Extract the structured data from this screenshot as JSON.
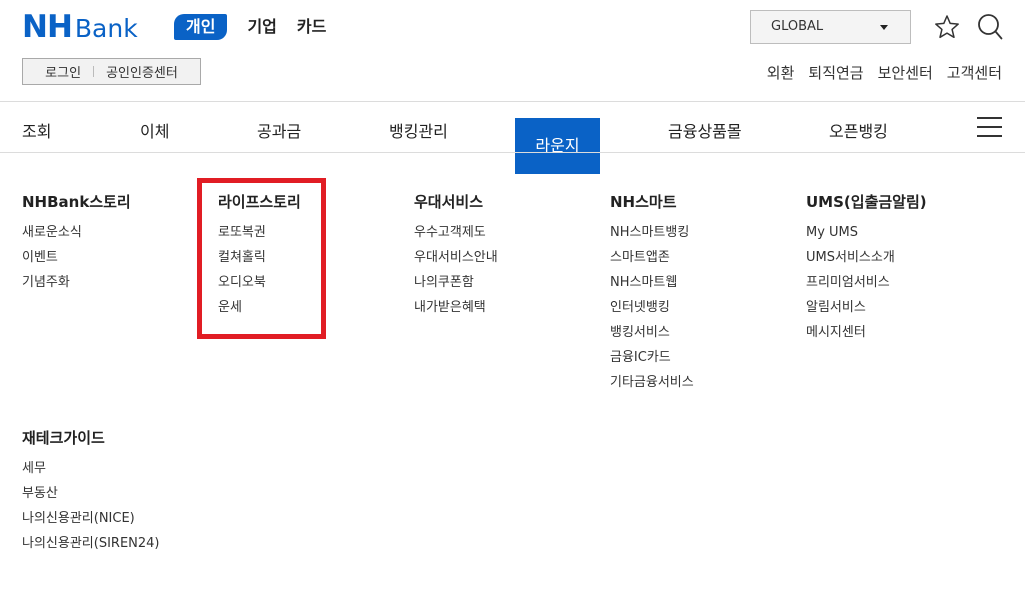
{
  "logo": {
    "nh": "NH",
    "bank": "Bank"
  },
  "segment_tabs": [
    {
      "label": "개인",
      "active": true
    },
    {
      "label": "기업",
      "active": false
    },
    {
      "label": "카드",
      "active": false
    }
  ],
  "login_box": {
    "login": "로그인",
    "cert_center": "공인인증센터"
  },
  "global_select": {
    "value": "GLOBAL"
  },
  "header_icons": [
    "star-icon",
    "search-icon"
  ],
  "util_links": [
    "외환",
    "퇴직연금",
    "보안센터",
    "고객센터"
  ],
  "gnb": {
    "items": [
      "조회",
      "이체",
      "공과금",
      "뱅킹관리",
      "라운지",
      "금융상품몰",
      "오픈뱅킹"
    ],
    "active": "라운지"
  },
  "mega_menu": [
    {
      "title": "NHBank스토리",
      "items": [
        "새로운소식",
        "이벤트",
        "기념주화"
      ]
    },
    {
      "title": "라이프스토리",
      "items": [
        "로또복권",
        "컬쳐홀릭",
        "오디오북",
        "운세"
      ]
    },
    {
      "title": "우대서비스",
      "items": [
        "우수고객제도",
        "우대서비스안내",
        "나의쿠폰함",
        "내가받은혜택"
      ]
    },
    {
      "title": "NH스마트",
      "items": [
        "NH스마트뱅킹",
        "스마트앱존",
        "NH스마트웹",
        "인터넷뱅킹",
        "뱅킹서비스",
        "금융IC카드",
        "기타금융서비스"
      ]
    },
    {
      "title": "UMS(입출금알림)",
      "items": [
        "My UMS",
        "UMS서비스소개",
        "프리미엄서비스",
        "알림서비스",
        "메시지센터"
      ]
    },
    {
      "title": "재테크가이드",
      "items": [
        "세무",
        "부동산",
        "나의신용관리(NICE)",
        "나의신용관리(SIREN24)"
      ]
    }
  ],
  "colors": {
    "brand_blue": "#0a62c6",
    "highlight_red": "#e11d24"
  }
}
